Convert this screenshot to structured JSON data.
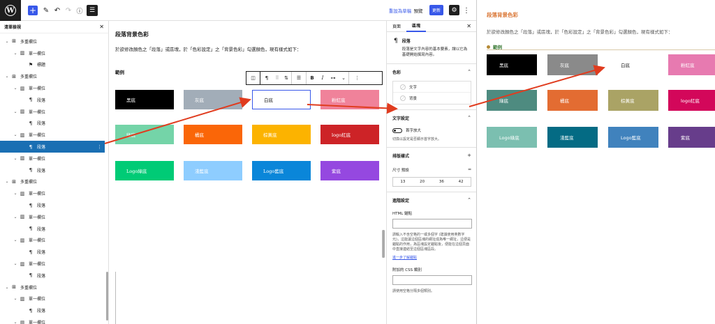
{
  "toolbar": {
    "save_label": "重設為草稿",
    "preview_label": "預覽",
    "update_label": "更新"
  },
  "listview": {
    "title": "清單檢視",
    "rows": [
      {
        "depth": 0,
        "icon": "columns-icon",
        "glyph": "⊞",
        "label": "多重欄位",
        "expanded": true
      },
      {
        "depth": 1,
        "icon": "column-icon",
        "glyph": "▥",
        "label": "單一欄位",
        "expanded": true
      },
      {
        "depth": 2,
        "icon": "bookmark-icon",
        "glyph": "⚑",
        "label": "標題",
        "expanded": null
      },
      {
        "depth": 0,
        "icon": "columns-icon",
        "glyph": "⊞",
        "label": "多重欄位",
        "expanded": true
      },
      {
        "depth": 1,
        "icon": "column-icon",
        "glyph": "▥",
        "label": "單一欄位",
        "expanded": true
      },
      {
        "depth": 2,
        "icon": "paragraph-icon",
        "glyph": "¶",
        "label": "段落",
        "expanded": null
      },
      {
        "depth": 1,
        "icon": "column-icon",
        "glyph": "▥",
        "label": "單一欄位",
        "expanded": true
      },
      {
        "depth": 2,
        "icon": "paragraph-icon",
        "glyph": "¶",
        "label": "段落",
        "expanded": null
      },
      {
        "depth": 1,
        "icon": "column-icon",
        "glyph": "▥",
        "label": "單一欄位",
        "expanded": true
      },
      {
        "depth": 2,
        "icon": "paragraph-icon",
        "glyph": "¶",
        "label": "段落",
        "expanded": null,
        "selected": true
      },
      {
        "depth": 1,
        "icon": "column-icon",
        "glyph": "▥",
        "label": "單一欄位",
        "expanded": true
      },
      {
        "depth": 2,
        "icon": "paragraph-icon",
        "glyph": "¶",
        "label": "段落",
        "expanded": null
      },
      {
        "depth": 0,
        "icon": "columns-icon",
        "glyph": "⊞",
        "label": "多重欄位",
        "expanded": true
      },
      {
        "depth": 1,
        "icon": "column-icon",
        "glyph": "▥",
        "label": "單一欄位",
        "expanded": true
      },
      {
        "depth": 2,
        "icon": "paragraph-icon",
        "glyph": "¶",
        "label": "段落",
        "expanded": null
      },
      {
        "depth": 1,
        "icon": "column-icon",
        "glyph": "▥",
        "label": "單一欄位",
        "expanded": true
      },
      {
        "depth": 2,
        "icon": "paragraph-icon",
        "glyph": "¶",
        "label": "段落",
        "expanded": null
      },
      {
        "depth": 1,
        "icon": "column-icon",
        "glyph": "▥",
        "label": "單一欄位",
        "expanded": true
      },
      {
        "depth": 2,
        "icon": "paragraph-icon",
        "glyph": "¶",
        "label": "段落",
        "expanded": null
      },
      {
        "depth": 1,
        "icon": "column-icon",
        "glyph": "▥",
        "label": "單一欄位",
        "expanded": true
      },
      {
        "depth": 2,
        "icon": "paragraph-icon",
        "glyph": "¶",
        "label": "段落",
        "expanded": null
      },
      {
        "depth": 0,
        "icon": "columns-icon",
        "glyph": "⊞",
        "label": "多重欄位",
        "expanded": true
      },
      {
        "depth": 1,
        "icon": "column-icon",
        "glyph": "▥",
        "label": "單一欄位",
        "expanded": true
      },
      {
        "depth": 2,
        "icon": "paragraph-icon",
        "glyph": "¶",
        "label": "段落",
        "expanded": null
      },
      {
        "depth": 1,
        "icon": "column-icon",
        "glyph": "▥",
        "label": "單一欄位",
        "expanded": true
      }
    ]
  },
  "canvas": {
    "title": "段落背景色彩",
    "description": "於欲修改顏色之「段落」或區塊，於「色彩設定」之「背景色彩」勾選顏色，現有樣式如下：",
    "heading": "範例",
    "swatches": [
      {
        "label": "黑底",
        "color": "#000000"
      },
      {
        "label": "灰底",
        "color": "#a2adb8"
      },
      {
        "label": "白底",
        "color": "#ffffff",
        "white": true
      },
      {
        "label": "粉紅底",
        "color": "#f0829a"
      },
      {
        "label": "綠底",
        "color": "#74d4a8"
      },
      {
        "label": "橘底",
        "color": "#fa6608"
      },
      {
        "label": "棕黃底",
        "color": "#fcb300"
      },
      {
        "label": "logo紅底",
        "color": "#cd2327"
      },
      {
        "label": "Logo綠底",
        "color": "#00cb76"
      },
      {
        "label": "淺藍底",
        "color": "#8ecdff"
      },
      {
        "label": "Logo藍底",
        "color": "#0a86d9"
      },
      {
        "label": "紫底",
        "color": "#9548e0"
      }
    ]
  },
  "settings": {
    "tab_page": "頁面",
    "tab_block": "區塊",
    "block_name": "段落",
    "block_desc": "段落是文字內容的基本要素，讓以它為基礎開始撰寫內容。",
    "color_title": "色彩",
    "color_text": "文字",
    "color_background": "背景",
    "typo_title": "文字設定",
    "dropcap": "首字放大",
    "dropcap_hint": "切換以設定是否顯示首字放大。",
    "style_title": "排版樣式",
    "size_label": "尺寸 預設",
    "sizes": [
      "13",
      "20",
      "36",
      "42"
    ],
    "adv_title": "進階設定",
    "anchor_label": "HTML 錨點",
    "anchor_hint": "請輸入不含空格的一或多個字 (建議使用英數字元)，這能讓這個區塊的網址成為唯一網址，這便是錨點的作用，為區塊設定錨點後，便能在這個頁面中直接連結至這個區塊區段。",
    "anchor_link": "進一步了解錨點",
    "css_label": "附加的 CSS 類別",
    "css_hint": "請使用空格分隔多個類別。"
  },
  "preview": {
    "title": "段落背景色彩",
    "description": "於欲修改顏色之「段落」或區塊，於「色彩設定」之「背景色彩」勾選顏色，現有樣式如下：",
    "heading": "範例",
    "swatches": [
      {
        "label": "黑底",
        "color": "#000000"
      },
      {
        "label": "灰底",
        "color": "#8a8a8a"
      },
      {
        "label": "白底",
        "color": "#ffffff",
        "white": true
      },
      {
        "label": "粉紅底",
        "color": "#e77ab0"
      },
      {
        "label": "綠底",
        "color": "#4e8b80"
      },
      {
        "label": "橘底",
        "color": "#e36c32"
      },
      {
        "label": "棕黃底",
        "color": "#aaa365"
      },
      {
        "label": "logo紅底",
        "color": "#d3075a"
      },
      {
        "label": "Logo綠底",
        "color": "#7bbfb0"
      },
      {
        "label": "淺藍底",
        "color": "#046b84"
      },
      {
        "label": "Logo藍底",
        "color": "#4082bd"
      },
      {
        "label": "紫底",
        "color": "#673d8b"
      }
    ]
  }
}
